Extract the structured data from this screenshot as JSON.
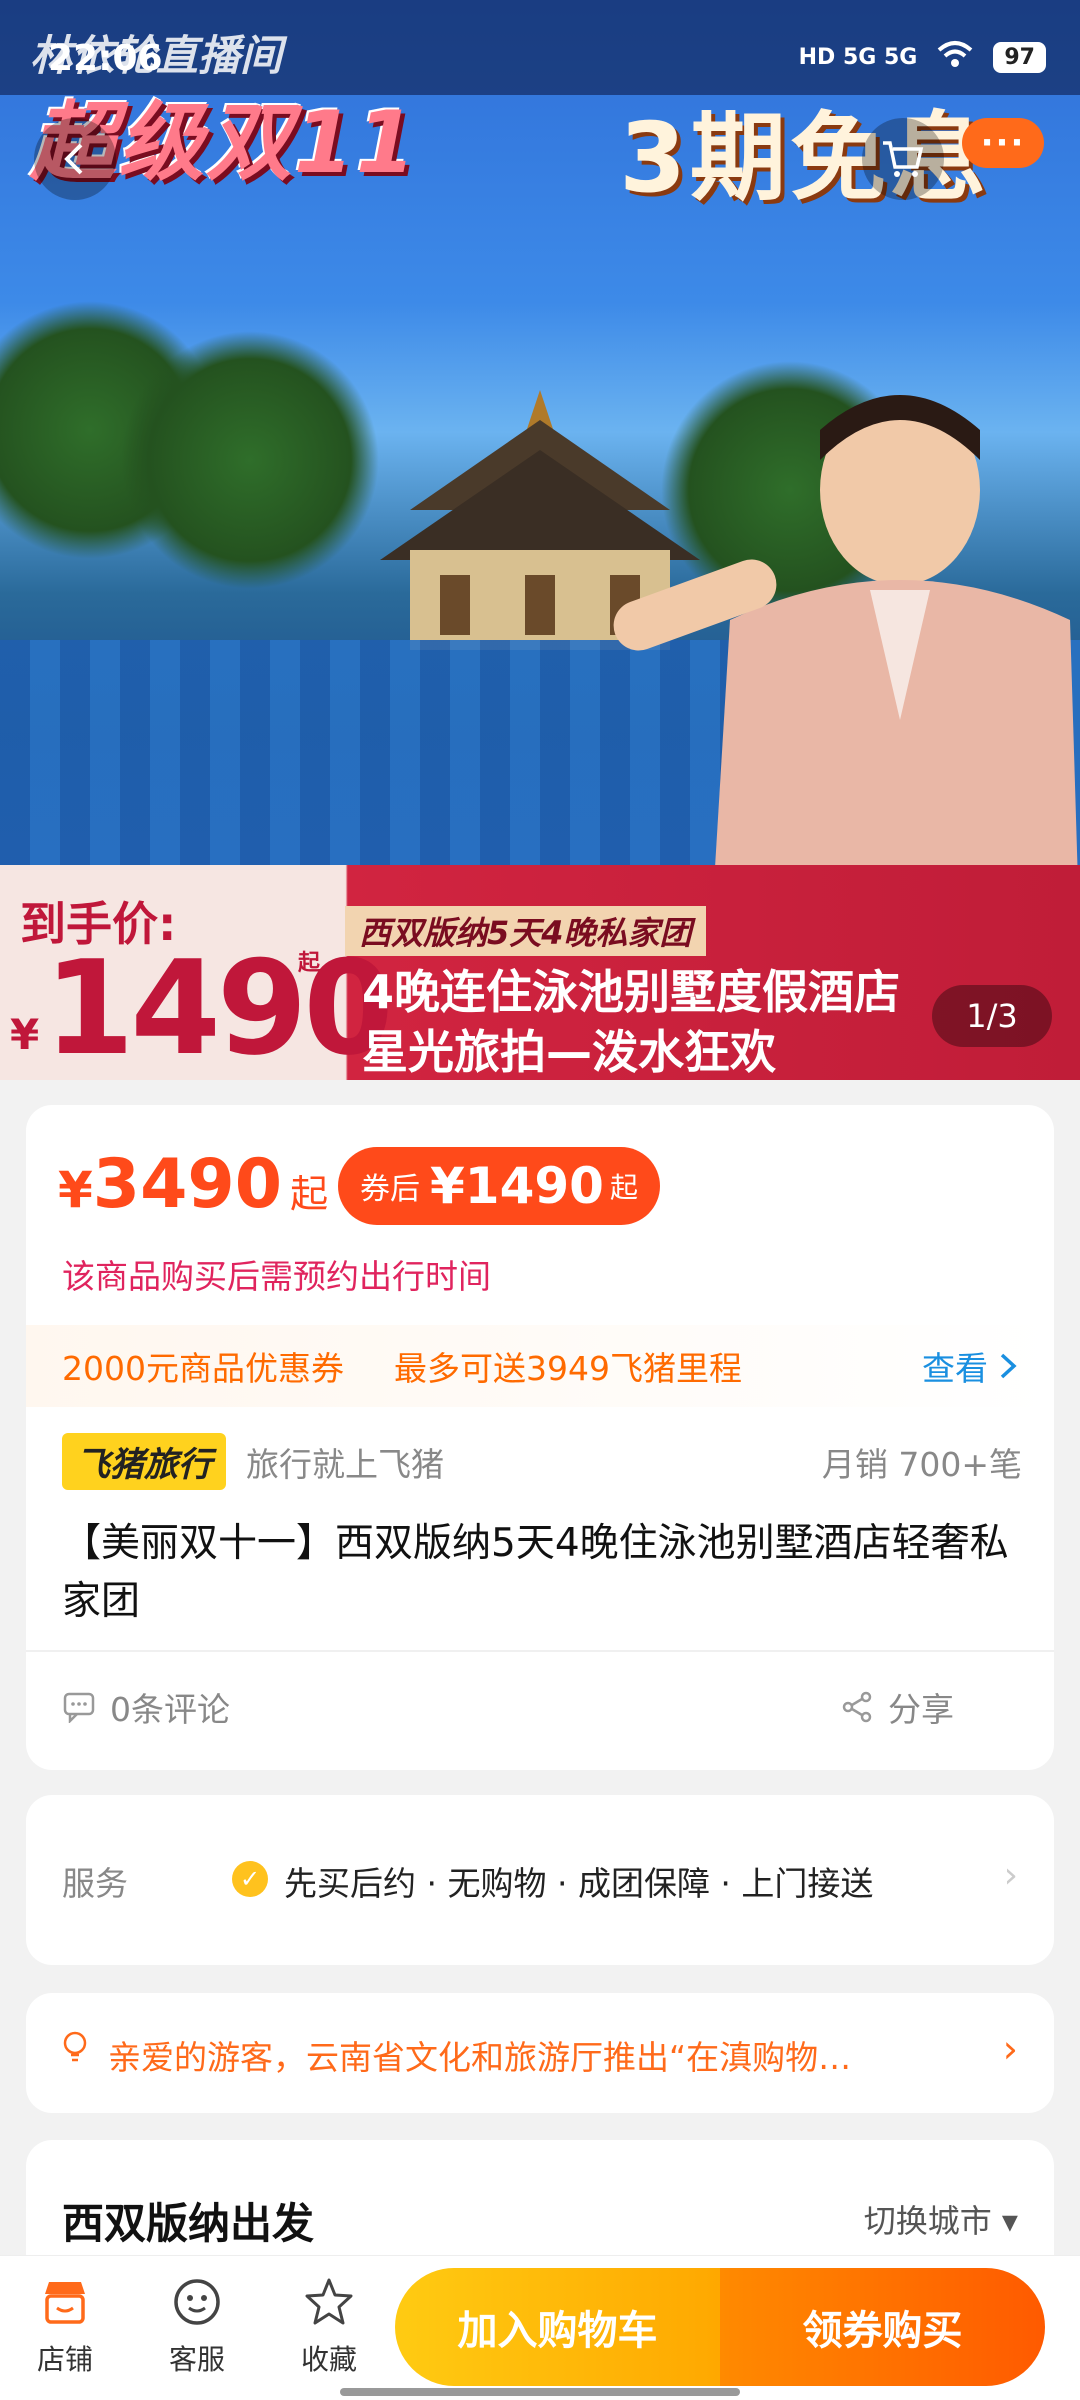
{
  "status_bar": {
    "time": "22:06",
    "network": "HD 5G 5G",
    "battery": "97"
  },
  "hero": {
    "live_tag": "林依轮直播间",
    "banner_title": "超级双11",
    "banner_right": "3期免息",
    "more_badge": "···",
    "price_label": "到手价:",
    "price_yen": "¥",
    "price_big": "1490",
    "price_qi": "起",
    "promo_sub": "西双版纳5天4晚私家团",
    "promo_line1": "4晚连住泳池别墅度假酒店",
    "promo_line2": "星光旅拍—泼水狂欢",
    "page_indicator": "1/3"
  },
  "product": {
    "price_yen": "¥",
    "price": "3490",
    "price_qi": "起",
    "coupon_label": "券后",
    "coupon_price": "¥1490",
    "coupon_qi": "起",
    "notice": "该商品购买后需预约出行时间",
    "promo_items": [
      "2000元商品优惠券",
      "最多可送3949飞猪里程"
    ],
    "promo_view": "查看",
    "brand_logo": "飞猪旅行",
    "brand_slogan": "旅行就上飞猪",
    "sales": "月销 700+笔",
    "title": "【美丽双十一】西双版纳5天4晚住泳池别墅酒店轻奢私家团",
    "reviews": "0条评论",
    "share": "分享"
  },
  "service": {
    "label": "服务",
    "text": "先买后约 · 无购物 · 成团保障 · 上门接送"
  },
  "tip": {
    "text": "亲爱的游客，云南省文化和旅游厅推出“在滇购物…"
  },
  "departure": {
    "title": "西双版纳出发",
    "switch": "切换城市 ▾"
  },
  "bottom_bar": {
    "tabs": [
      {
        "label": "店铺"
      },
      {
        "label": "客服"
      },
      {
        "label": "收藏"
      }
    ],
    "add_cart": "加入购物车",
    "buy": "领券购买"
  },
  "colors": {
    "accent": "#ff4a1a",
    "orange": "#ff6a1a",
    "yellow": "#ffc21e",
    "blue_link": "#1a8fe0"
  }
}
